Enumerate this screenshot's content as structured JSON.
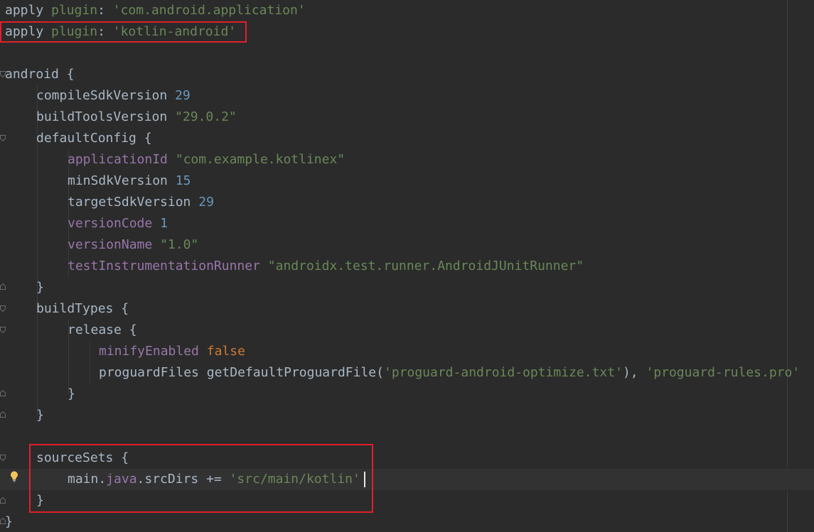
{
  "lines": {
    "l1": {
      "apply": "apply",
      "plugin": "plugin",
      "colon": ": ",
      "value": "'com.android.application'"
    },
    "l2": {
      "apply": "apply",
      "plugin": "plugin",
      "colon": ": ",
      "value": "'kotlin-android'"
    },
    "l4": {
      "text": "android {"
    },
    "l5": {
      "name": "compileSdkVersion",
      "value": "29"
    },
    "l6": {
      "name": "buildToolsVersion",
      "value": "\"29.0.2\""
    },
    "l7": {
      "text": "defaultConfig {"
    },
    "l8": {
      "name": "applicationId",
      "value": "\"com.example.kotlinex\""
    },
    "l9": {
      "name": "minSdkVersion",
      "value": "15"
    },
    "l10": {
      "name": "targetSdkVersion",
      "value": "29"
    },
    "l11": {
      "name": "versionCode",
      "value": "1"
    },
    "l12": {
      "name": "versionName",
      "value": "\"1.0\""
    },
    "l13": {
      "name": "testInstrumentationRunner",
      "value": "\"androidx.test.runner.AndroidJUnitRunner\""
    },
    "l14": {
      "text": "}"
    },
    "l15": {
      "text": "buildTypes {"
    },
    "l16": {
      "text": "release {"
    },
    "l17": {
      "name": "minifyEnabled",
      "value": "false"
    },
    "l18": {
      "name": "proguardFiles",
      "call": "getDefaultProguardFile(",
      "arg1": "'proguard-android-optimize.txt'",
      "sep": "), ",
      "arg2": "'proguard-rules.pro'"
    },
    "l19": {
      "text": "}"
    },
    "l20": {
      "text": "}"
    },
    "l22": {
      "text": "sourceSets {"
    },
    "l23": {
      "obj": "main.",
      "field": "java",
      "rest": ".srcDirs += ",
      "value": "'src/main/kotlin'"
    },
    "l24": {
      "text": "}"
    },
    "l25": {
      "text": "}"
    }
  },
  "icons": {
    "fold": "fold-marker-icon",
    "intention": "lightbulb-icon"
  },
  "colors": {
    "background": "#2b2b2b",
    "current_line": "#323232",
    "keyword": "#cc7832",
    "string": "#6a8759",
    "number": "#6897bb",
    "property": "#9876aa",
    "text": "#a9b7c6",
    "annotation_box": "#e0202a"
  }
}
